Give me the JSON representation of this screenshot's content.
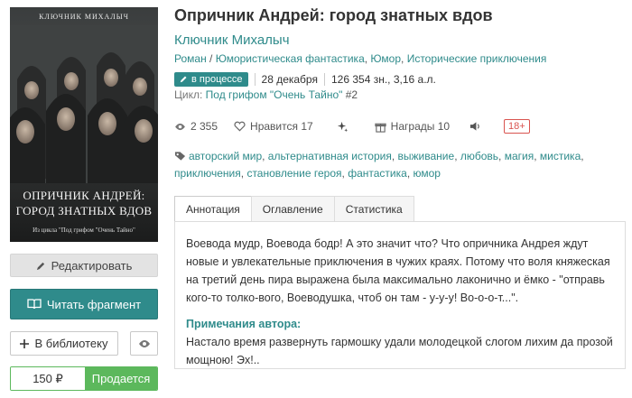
{
  "cover": {
    "author": "КЛЮЧНИК МИХАЛЫЧ",
    "title_line1": "ОПРИЧНИК АНДРЕЙ:",
    "title_line2": "ГОРОД ЗНАТНЫХ ВДОВ",
    "series": "Из цикла \"Под грифом \"Очень Тайно\""
  },
  "actions": {
    "edit": "Редактировать",
    "read": "Читать фрагмент",
    "library": "В библиотеку",
    "price": "150 ₽",
    "sell": "Продается"
  },
  "book": {
    "title": "Опричник Андрей: город знатных вдов",
    "author": "Ключник Михалыч",
    "genres": [
      "Роман",
      "Юмористическая фантастика",
      "Юмор",
      "Исторические приключения"
    ],
    "status": "в процессе",
    "date": "28 декабря",
    "size": "126 354 зн., 3,16 а.л.",
    "cycle_label": "Цикл:",
    "cycle_name": "Под грифом \"Очень Тайно\"",
    "cycle_num": "#2"
  },
  "stats": {
    "views": "2 355",
    "likes": "Нравится 17",
    "awards": "Награды 10",
    "age": "18+"
  },
  "tags": [
    "авторский мир",
    "альтернативная история",
    "выживание",
    "любовь",
    "магия",
    "мистика",
    "приключения",
    "становление героя",
    "фантастика",
    "юмор"
  ],
  "tabs": [
    "Аннотация",
    "Оглавление",
    "Статистика"
  ],
  "annotation": {
    "text": "Воевода мудр, Воевода бодр! А это значит что? Что опричника Андрея ждут новые и увлекательные приключения в чужих краях. Потому что воля княжеская на третий день пира выражена была максимально лаконично и ёмко - \"отправь кого-то толко-вого, Воеводушка, чтоб он там - у-у-у! Во-о-о-т...\".",
    "note_title": "Примечания автора:",
    "note_text": "Настало время развернуть гармошку удали молодецкой слогом лихим да прозой мощною! Эх!.."
  },
  "colors": {
    "accent": "#2f8b8b",
    "sell": "#5cb85c",
    "age": "#d9534f"
  }
}
